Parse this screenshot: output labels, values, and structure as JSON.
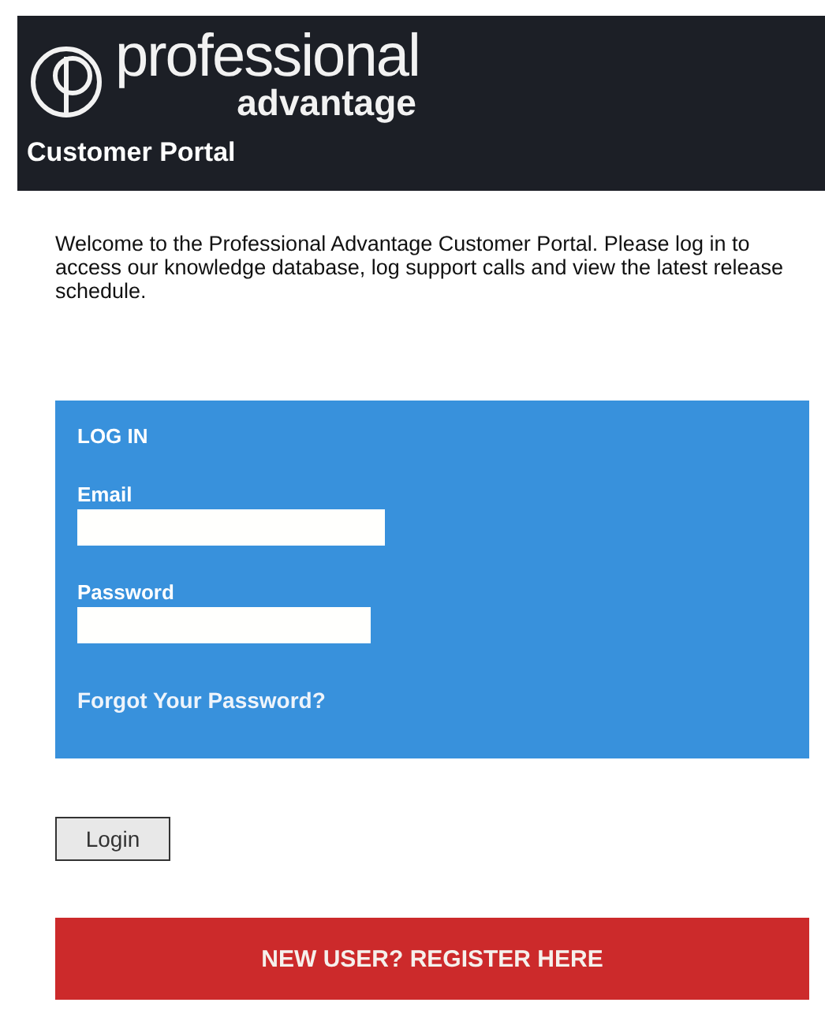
{
  "header": {
    "logo_word": "professional",
    "logo_sub": "advantage",
    "title": "Customer Portal"
  },
  "intro": "Welcome to the Professional Advantage Customer Portal. Please log in to access our knowledge database, log support calls and view the latest release schedule.",
  "login_panel": {
    "heading": "LOG IN",
    "fields": [
      {
        "label": "Email",
        "kind": "text"
      },
      {
        "label": "Password",
        "kind": "password"
      }
    ],
    "forgot_link": "Forgot Your Password?"
  },
  "login_button": "Login",
  "register_button": "NEW USER? REGISTER HERE"
}
